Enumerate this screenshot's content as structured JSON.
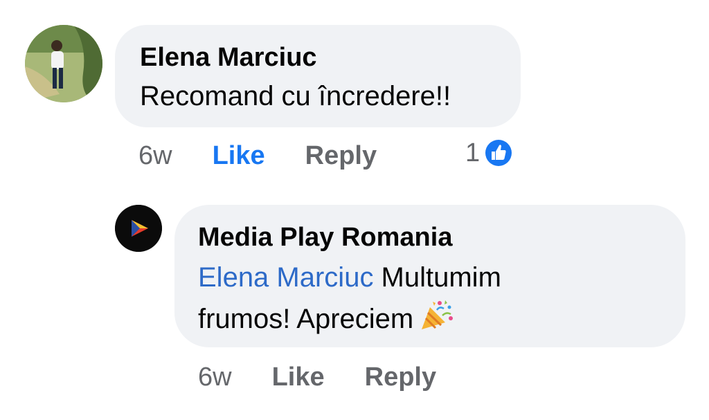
{
  "comments": [
    {
      "author": "Elena Marciuc",
      "text": "Recomand cu încredere!!",
      "time": "6w",
      "like_label": "Like",
      "reply_label": "Reply",
      "reaction_count": "1",
      "reaction_icon": "thumbs-up-icon",
      "liked": true
    },
    {
      "author": "Media Play Romania",
      "mention": "Elena Marciuc",
      "text_line1": " Multumim",
      "text_line2": "frumos! Apreciem",
      "emoji_icon": "party-popper-icon",
      "time": "6w",
      "like_label": "Like",
      "reply_label": "Reply"
    }
  ],
  "colors": {
    "bubble": "#f0f2f5",
    "link": "#2d6ac8",
    "like_active": "#1877f2",
    "meta_text": "#65676b"
  }
}
